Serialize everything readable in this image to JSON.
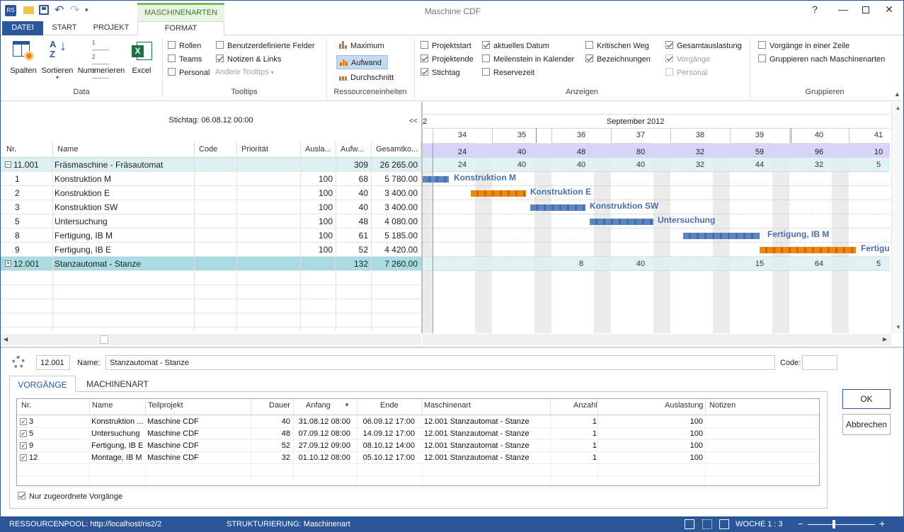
{
  "title": "Maschine CDF",
  "context_tab": "MASCHINENARTEN",
  "ribbon_tabs": [
    "DATEI",
    "START",
    "PROJEKT",
    "FORMAT"
  ],
  "ribbon": {
    "data_group": {
      "label": "Data",
      "buttons": [
        "Spalten",
        "Sortieren",
        "Nummerieren",
        "Excel"
      ]
    },
    "tooltips_group": {
      "label": "Tooltips",
      "items": [
        {
          "label": "Rollen",
          "checked": false
        },
        {
          "label": "Teams",
          "checked": false
        },
        {
          "label": "Personal",
          "checked": false
        },
        {
          "label": "Benutzerdefinierte Felder",
          "checked": false
        },
        {
          "label": "Notizen & Links",
          "checked": true
        }
      ],
      "other": "Andere Tooltips"
    },
    "res_group": {
      "label": "Ressourceneinheiten",
      "items": [
        "Maximum",
        "Aufwand",
        "Durchschnitt"
      ],
      "selected": "Aufwand"
    },
    "anzeigen_group": {
      "label": "Anzeigen",
      "items": [
        {
          "label": "Projektstart",
          "checked": false
        },
        {
          "label": "Projektende",
          "checked": true
        },
        {
          "label": "Stichtag",
          "checked": true
        },
        {
          "label": "aktuelles Datum",
          "checked": true
        },
        {
          "label": "Meilenstein in Kalender",
          "checked": false
        },
        {
          "label": "Reservezeit",
          "checked": false
        },
        {
          "label": "Kritischen Weg",
          "checked": false
        },
        {
          "label": "Bezeichnungen",
          "checked": true
        },
        {
          "label": "Gesamtauslastung",
          "checked": true
        },
        {
          "label": "Vorgänge",
          "checked": true,
          "disabled": true
        },
        {
          "label": "Personal",
          "checked": false,
          "disabled": true
        }
      ]
    },
    "gruppieren_group": {
      "label": "Gruppieren",
      "items": [
        {
          "label": "Vorgänge in einer Zeile",
          "checked": false
        },
        {
          "label": "Gruppieren nach Maschinenarten",
          "checked": false
        }
      ]
    }
  },
  "grid": {
    "stichtag": "Stichtag: 06.08.12 00:00",
    "nav": "<<",
    "columns": [
      "Nr.",
      "Name",
      "Code",
      "Priorität",
      "Ausla...",
      "Aufw...",
      "Gesamtko..."
    ],
    "rows": [
      {
        "nr": "11.001",
        "name": "Fräsmaschine - Fräsautomat",
        "code": "",
        "prio": "",
        "ausl": "",
        "aufw": "309",
        "total": "26 265.00",
        "group": true,
        "toggle": "−"
      },
      {
        "nr": "1",
        "name": "Konstruktion M",
        "code": "",
        "prio": "",
        "ausl": "100",
        "aufw": "68",
        "total": "5 780.00"
      },
      {
        "nr": "2",
        "name": "Konstruktion E",
        "code": "",
        "prio": "",
        "ausl": "100",
        "aufw": "40",
        "total": "3 400.00"
      },
      {
        "nr": "3",
        "name": "Konstruktion SW",
        "code": "",
        "prio": "",
        "ausl": "100",
        "aufw": "40",
        "total": "3 400.00"
      },
      {
        "nr": "5",
        "name": "Untersuchung",
        "code": "",
        "prio": "",
        "ausl": "100",
        "aufw": "48",
        "total": "4 080.00"
      },
      {
        "nr": "8",
        "name": "Fertigung, IB M",
        "code": "",
        "prio": "",
        "ausl": "100",
        "aufw": "61",
        "total": "5 185.00"
      },
      {
        "nr": "9",
        "name": "Fertigung, IB E",
        "code": "",
        "prio": "",
        "ausl": "100",
        "aufw": "52",
        "total": "4 420.00"
      },
      {
        "nr": "12.001",
        "name": "Stanzautomat - Stanze",
        "code": "",
        "prio": "",
        "ausl": "",
        "aufw": "132",
        "total": "7 260.00",
        "group": true,
        "selected": true,
        "toggle": "+"
      }
    ]
  },
  "gantt": {
    "month": "September 2012",
    "month_prev_fragment": "2",
    "weeks": [
      "34",
      "35",
      "36",
      "37",
      "38",
      "39",
      "40",
      "41"
    ],
    "totals": [
      "24",
      "40",
      "48",
      "80",
      "32",
      "59",
      "96",
      "10"
    ],
    "group1_values": [
      "24",
      "40",
      "40",
      "40",
      "32",
      "44",
      "32",
      "5"
    ],
    "group2_values": [
      "",
      "",
      "8",
      "40",
      "",
      "15",
      "64",
      "5"
    ],
    "bars": [
      {
        "label": "Konstruktion M",
        "color": "#5b86c6"
      },
      {
        "label": "Konstruktion E",
        "color": "#f0860a"
      },
      {
        "label": "Konstruktion SW",
        "color": "#5b86c6"
      },
      {
        "label": "Untersuchung",
        "color": "#5b86c6"
      },
      {
        "label": "Fertigung, IB M",
        "color": "#5b86c6"
      },
      {
        "label": "Fertigung, IB E",
        "color": "#f0860a"
      }
    ]
  },
  "detail": {
    "nr": "12.001",
    "name_label": "Name:",
    "name_value": "Stanzautomat - Stanze",
    "code_label": "Code:",
    "code_value": "",
    "tabs": [
      "VORGÄNGE",
      "MACHINENART"
    ],
    "columns": [
      "Nr.",
      "Name",
      "Teilprojekt",
      "Dauer",
      "Anfang",
      "Ende",
      "Maschinenart",
      "Anzahl",
      "Auslastung",
      "Notizen"
    ],
    "rows": [
      {
        "nr": "3",
        "name": "Konstruktion ...",
        "teil": "Maschine CDF",
        "dauer": "40",
        "anfang": "31.08.12 08:00",
        "ende": "06.09.12 17:00",
        "art": "12.001 Stanzautomat - Stanze",
        "anzahl": "1",
        "ausl": "100",
        "notizen": ""
      },
      {
        "nr": "5",
        "name": "Untersuchung",
        "teil": "Maschine CDF",
        "dauer": "48",
        "anfang": "07.09.12 08:00",
        "ende": "14.09.12 17:00",
        "art": "12.001 Stanzautomat - Stanze",
        "anzahl": "1",
        "ausl": "100",
        "notizen": ""
      },
      {
        "nr": "9",
        "name": "Fertigung, IB E",
        "teil": "Maschine CDF",
        "dauer": "52",
        "anfang": "27.09.12 09:00",
        "ende": "08.10.12 14:00",
        "art": "12.001 Stanzautomat - Stanze",
        "anzahl": "1",
        "ausl": "100",
        "notizen": ""
      },
      {
        "nr": "12",
        "name": "Montage, IB M",
        "teil": "Maschine CDF",
        "dauer": "32",
        "anfang": "01.10.12 08:00",
        "ende": "05.10.12 17:00",
        "art": "12.001 Stanzautomat - Stanze",
        "anzahl": "1",
        "ausl": "100",
        "notizen": ""
      }
    ],
    "only_assigned": "Nur zugeordnete Vorgänge",
    "ok": "OK",
    "cancel": "Abbrechen"
  },
  "status": {
    "pool": "RESSOURCENPOOL: http://localhost/ris2/2",
    "struct": "STRUKTURIERUNG: Maschinenart",
    "zoom": "WOCHE 1 : 3"
  },
  "colors": {
    "accent": "#2b579a",
    "group_row": "#dcf0f2",
    "selected_group": "#a9dce2",
    "bar_blue": "#5b86c6",
    "bar_orange": "#f0860a"
  }
}
